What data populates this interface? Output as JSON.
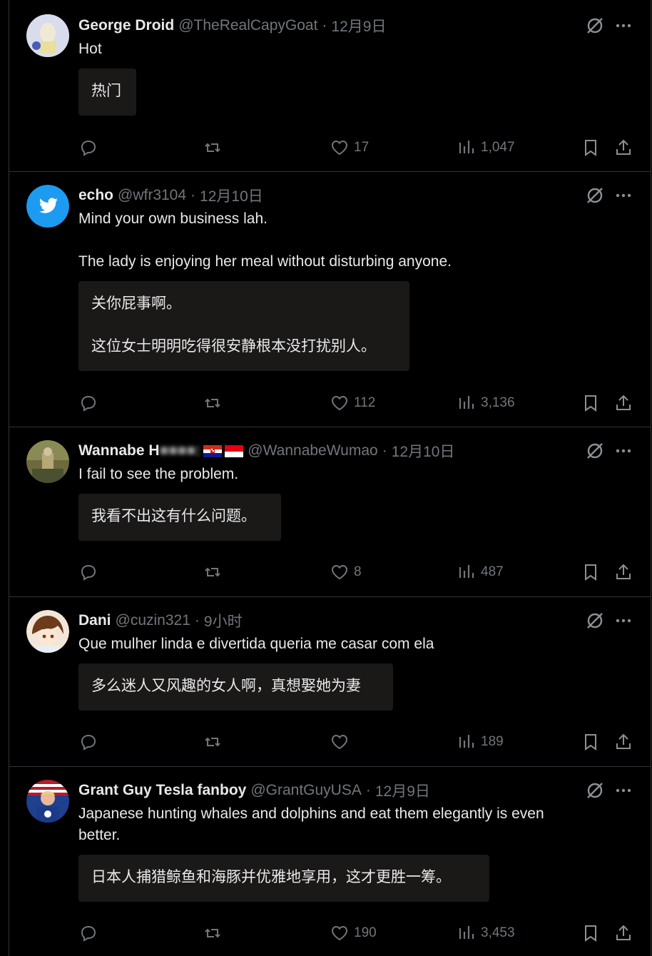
{
  "tweets": [
    {
      "name": "George Droid",
      "handle": "@TheRealCapyGoat",
      "separator": "·",
      "time": "12月9日",
      "text": [
        "Hot"
      ],
      "translation": [
        "热门"
      ],
      "replies": "",
      "retweets": "",
      "likes": "17",
      "views": "1,047"
    },
    {
      "name": "echo",
      "handle": "@wfr3104",
      "separator": "·",
      "time": "12月10日",
      "text": [
        "Mind your own business lah.",
        "",
        "The lady is enjoying her meal without disturbing anyone."
      ],
      "translation": [
        "关你屁事啊。",
        "",
        "这位女士明明吃得很安静根本没打扰别人。"
      ],
      "replies": "",
      "retweets": "",
      "likes": "112",
      "views": "3,136"
    },
    {
      "name": "Wannabe H",
      "name_blurred": "",
      "handle": "@WannabeWumao",
      "separator": "·",
      "time": "12月10日",
      "text": [
        "I fail to see the problem."
      ],
      "translation": [
        "我看不出这有什么问题。"
      ],
      "replies": "",
      "retweets": "",
      "likes": "8",
      "views": "487"
    },
    {
      "name": "Dani",
      "handle": "@cuzin321",
      "separator": "·",
      "time": "9小时",
      "text": [
        "Que mulher linda e divertida queria me casar com ela"
      ],
      "translation": [
        "多么迷人又风趣的女人啊，真想娶她为妻"
      ],
      "replies": "",
      "retweets": "",
      "likes": "",
      "views": "189"
    },
    {
      "name": "Grant Guy Tesla fanboy",
      "handle": "@GrantGuyUSA",
      "separator": "·",
      "time": "12月9日",
      "text": [
        "Japanese hunting whales and dolphins and eat them elegantly is even",
        "better."
      ],
      "translation": [
        "日本人捕猎鲸鱼和海豚并优雅地享用，这才更胜一筹。"
      ],
      "replies": "",
      "retweets": "",
      "likes": "190",
      "views": "3,453"
    }
  ],
  "colors": {
    "background": "#000000",
    "text": "#e7e9ea",
    "muted": "#71767b",
    "divider": "#2f3336",
    "translation_box": "#1b1818",
    "twitter_blue": "#1d9bf0"
  },
  "icons": [
    "reply-icon",
    "retweet-icon",
    "like-icon",
    "views-icon",
    "bookmark-icon",
    "share-icon",
    "grok-icon",
    "more-icon"
  ]
}
